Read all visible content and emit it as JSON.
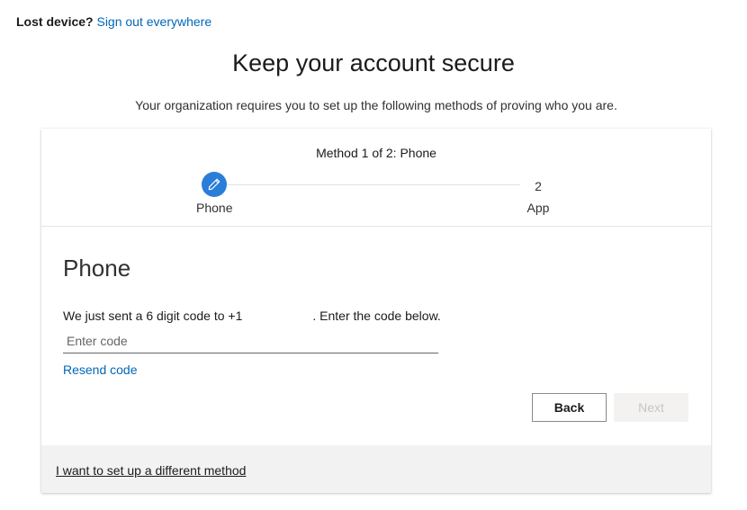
{
  "topbar": {
    "lost_device": "Lost device?",
    "sign_out_link": "Sign out everywhere"
  },
  "page": {
    "title": "Keep your account secure",
    "subtitle": "Your organization requires you to set up the following methods of proving who you are."
  },
  "wizard": {
    "method_header": "Method 1 of 2: Phone",
    "steps": [
      {
        "icon": "pencil-icon",
        "label": "Phone",
        "active": true
      },
      {
        "number": "2",
        "label": "App",
        "active": false
      }
    ],
    "accent_color": "#2a7ed9"
  },
  "phone": {
    "section_title": "Phone",
    "instruction_prefix": "We just sent a 6 digit code to +1",
    "instruction_suffix": ". Enter the code below.",
    "code_input": {
      "placeholder": "Enter code",
      "value": ""
    },
    "resend_link": "Resend code"
  },
  "actions": {
    "back_label": "Back",
    "next_label": "Next"
  },
  "footer": {
    "different_method_link": "I want to set up a different method"
  },
  "colors": {
    "link": "#0067b8",
    "text": "#1b1b1b",
    "footer_bg": "#f2f2f2"
  }
}
